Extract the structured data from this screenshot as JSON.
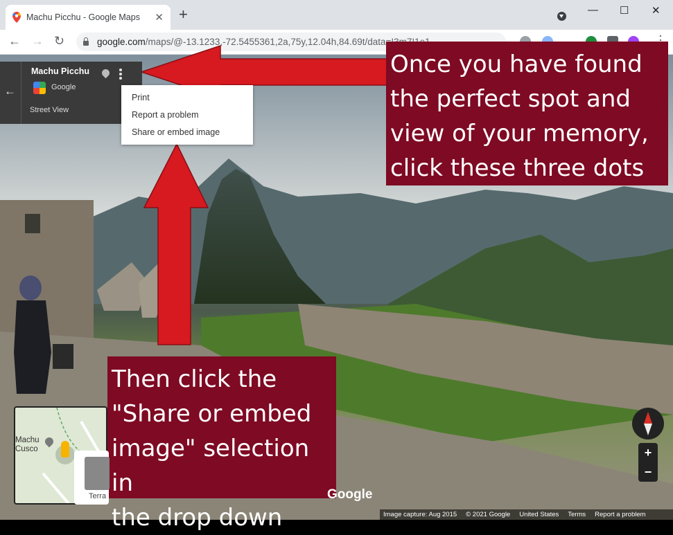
{
  "browser": {
    "tab_title": "Machu Picchu - Google Maps",
    "tab_close": "✕",
    "new_tab": "+",
    "url_host": "google.com",
    "url_path": "/maps/@-13.1",
    "url_rest": "233,-72.5455361,2a,75y,12.04h,84.69t/data=!3m7!1e1",
    "back": "←",
    "forward": "→",
    "reload": "↻",
    "minimize": "—",
    "maximize": "☐",
    "close": "✕",
    "menu": "⋮"
  },
  "maps_panel": {
    "back_arrow": "←",
    "title": "Machu Picchu",
    "provider": "Google",
    "street_view_label": "Street View"
  },
  "dropdown": {
    "items": [
      "Print",
      "Report a problem",
      "Share or embed image"
    ]
  },
  "callouts": {
    "top": [
      "Once you have found",
      "the perfect spot and",
      "view of your memory,",
      "click these three dots"
    ],
    "bottom": [
      "Then click the",
      "\"Share or embed",
      "image\" selection in",
      "the drop down"
    ]
  },
  "minimap": {
    "place_line1": "Machu",
    "place_line2": "Cusco",
    "terrain_label": "Terra"
  },
  "zoom": {
    "in": "+",
    "out": "−"
  },
  "watermark": "Google",
  "footer": {
    "capture": "Image capture: Aug 2015",
    "copyright": "© 2021 Google",
    "country": "United States",
    "terms": "Terms",
    "report": "Report a problem"
  },
  "colors": {
    "callout_bg": "#7e0a23",
    "arrow_red": "#d71920",
    "panel_bg": "#3a3a3a"
  }
}
